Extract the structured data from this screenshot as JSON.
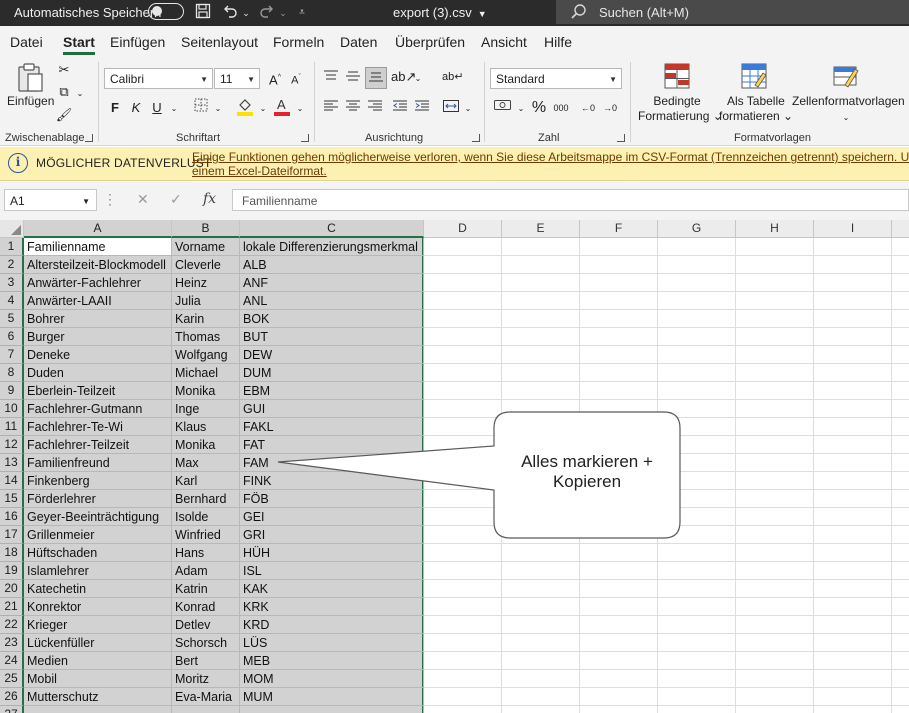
{
  "titlebar": {
    "autosave_label": "Automatisches Speichern",
    "autosave_state": "off",
    "filename": "export (3).csv",
    "search_placeholder": "Suchen (Alt+M)"
  },
  "menu": {
    "tabs": [
      {
        "label": "Datei",
        "active": false
      },
      {
        "label": "Start",
        "active": true
      },
      {
        "label": "Einfügen",
        "active": false
      },
      {
        "label": "Seitenlayout",
        "active": false
      },
      {
        "label": "Formeln",
        "active": false
      },
      {
        "label": "Daten",
        "active": false
      },
      {
        "label": "Überprüfen",
        "active": false
      },
      {
        "label": "Ansicht",
        "active": false
      },
      {
        "label": "Hilfe",
        "active": false
      }
    ]
  },
  "ribbon": {
    "clipboard": {
      "paste_label": "Einfügen",
      "group_label": "Zwischenablage"
    },
    "font": {
      "font_name": "Calibri",
      "font_size": "11",
      "bold": "F",
      "italic": "K",
      "underline": "U",
      "group_label": "Schriftart"
    },
    "alignment": {
      "group_label": "Ausrichtung"
    },
    "number": {
      "format": "Standard",
      "group_label": "Zahl"
    },
    "styles": {
      "conditional_line1": "Bedingte",
      "conditional_line2": "Formatierung",
      "table_line1": "Als Tabelle",
      "table_line2": "formatieren",
      "cellstyles_label": "Zellenformatvorlagen",
      "group_label": "Formatvorlagen"
    }
  },
  "infobar": {
    "title": "MÖGLICHER DATENVERLUST",
    "message_line1": "Einige Funktionen gehen möglicherweise verloren, wenn Sie diese Arbeitsmappe im CSV-Format (Trennzeichen getrennt) speichern. Um diese Funk",
    "message_line2": "einem Excel-Dateiformat."
  },
  "formulabar": {
    "name_box": "A1",
    "formula": "Familienname"
  },
  "grid": {
    "columns": [
      "A",
      "B",
      "C",
      "D",
      "E",
      "F",
      "G",
      "H",
      "I"
    ],
    "row_numbers": [
      "1",
      "2",
      "3",
      "4",
      "5",
      "6",
      "7",
      "8",
      "9",
      "10",
      "11",
      "12",
      "13",
      "14",
      "15",
      "16",
      "17",
      "18",
      "19",
      "20",
      "21",
      "22",
      "23",
      "24",
      "25",
      "26",
      "27"
    ],
    "rows": [
      [
        "Familienname",
        "Vorname",
        "lokale Differenzierungsmerkmal"
      ],
      [
        "Altersteilzeit-Blockmodell",
        "Cleverle",
        "ALB"
      ],
      [
        "Anwärter-Fachlehrer",
        "Heinz",
        "ANF"
      ],
      [
        "Anwärter-LAAII",
        "Julia",
        "ANL"
      ],
      [
        "Bohrer",
        "Karin",
        "BOK"
      ],
      [
        "Burger",
        "Thomas",
        "BUT"
      ],
      [
        "Deneke",
        "Wolfgang",
        "DEW"
      ],
      [
        "Duden",
        "Michael",
        "DUM"
      ],
      [
        "Eberlein-Teilzeit",
        "Monika",
        "EBM"
      ],
      [
        "Fachlehrer-Gutmann",
        "Inge",
        "GUI"
      ],
      [
        "Fachlehrer-Te-Wi",
        "Klaus",
        "FAKL"
      ],
      [
        "Fachlehrer-Teilzeit",
        "Monika",
        "FAT"
      ],
      [
        "Familienfreund",
        "Max",
        "FAM"
      ],
      [
        "Finkenberg",
        "Karl",
        "FINK"
      ],
      [
        "Förderlehrer",
        "Bernhard",
        "FÖB"
      ],
      [
        "Geyer-Beeinträchtigung",
        "Isolde",
        "GEI"
      ],
      [
        "Grillenmeier",
        "Winfried",
        "GRI"
      ],
      [
        "Hüftschaden",
        "Hans",
        "HÜH"
      ],
      [
        "Islamlehrer",
        "Adam",
        "ISL"
      ],
      [
        "Katechetin",
        "Katrin",
        "KAK"
      ],
      [
        "Konrektor",
        "Konrad",
        "KRK"
      ],
      [
        "Krieger",
        "Detlev",
        "KRD"
      ],
      [
        "Lückenfüller",
        "Schorsch",
        "LÜS"
      ],
      [
        "Medien",
        "Bert",
        "MEB"
      ],
      [
        "Mobil",
        "Moritz",
        "MOM"
      ],
      [
        "Mutterschutz",
        "Eva-Maria",
        "MUM"
      ]
    ]
  },
  "callout": {
    "line1": "Alles markieren +",
    "line2": "Kopieren"
  }
}
